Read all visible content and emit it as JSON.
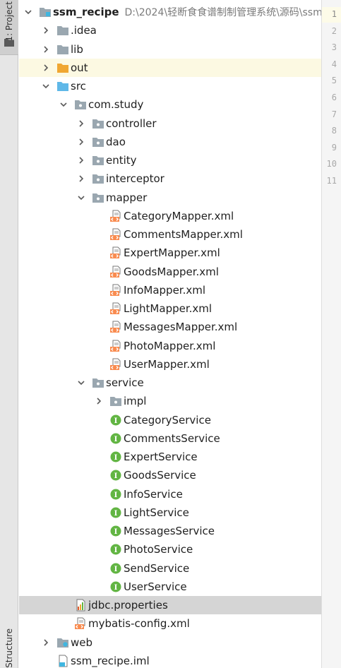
{
  "sidebar": {
    "project_tab": "1: Project",
    "structure_tab": "Structure"
  },
  "gutter": {
    "line_numbers": [
      "1",
      "2",
      "3",
      "4",
      "5",
      "6",
      "7",
      "8",
      "9",
      "10",
      "11"
    ]
  },
  "tree": {
    "root_name": "ssm_recipe",
    "root_path": "D:\\2024\\轻断食食谱制制管理系统\\源码\\ssm",
    "nodes": [
      {
        "label": "ssm_recipe",
        "level": 0,
        "arrow": "down",
        "icon": "module-folder-icon",
        "name": "tree-node-ssm-recipe"
      },
      {
        "label": ".idea",
        "level": 1,
        "arrow": "right",
        "icon": "folder-icon",
        "name": "tree-node-idea"
      },
      {
        "label": "lib",
        "level": 1,
        "arrow": "right",
        "icon": "folder-icon",
        "name": "tree-node-lib"
      },
      {
        "label": "out",
        "level": 1,
        "arrow": "right",
        "icon": "excluded-folder-icon",
        "name": "tree-node-out"
      },
      {
        "label": "src",
        "level": 1,
        "arrow": "down",
        "icon": "source-folder-icon",
        "name": "tree-node-src"
      },
      {
        "label": "com.study",
        "level": 2,
        "arrow": "down",
        "icon": "package-icon",
        "name": "tree-node-com-study"
      },
      {
        "label": "controller",
        "level": 3,
        "arrow": "right",
        "icon": "package-icon",
        "name": "tree-node-controller"
      },
      {
        "label": "dao",
        "level": 3,
        "arrow": "right",
        "icon": "package-icon",
        "name": "tree-node-dao"
      },
      {
        "label": "entity",
        "level": 3,
        "arrow": "right",
        "icon": "package-icon",
        "name": "tree-node-entity"
      },
      {
        "label": "interceptor",
        "level": 3,
        "arrow": "right",
        "icon": "package-icon",
        "name": "tree-node-interceptor"
      },
      {
        "label": "mapper",
        "level": 3,
        "arrow": "down",
        "icon": "package-icon",
        "name": "tree-node-mapper"
      },
      {
        "label": "CategoryMapper.xml",
        "level": 4,
        "arrow": "none",
        "icon": "xml-file-icon",
        "name": "tree-node-category-mapper"
      },
      {
        "label": "CommentsMapper.xml",
        "level": 4,
        "arrow": "none",
        "icon": "xml-file-icon",
        "name": "tree-node-comments-mapper"
      },
      {
        "label": "ExpertMapper.xml",
        "level": 4,
        "arrow": "none",
        "icon": "xml-file-icon",
        "name": "tree-node-expert-mapper"
      },
      {
        "label": "GoodsMapper.xml",
        "level": 4,
        "arrow": "none",
        "icon": "xml-file-icon",
        "name": "tree-node-goods-mapper"
      },
      {
        "label": "InfoMapper.xml",
        "level": 4,
        "arrow": "none",
        "icon": "xml-file-icon",
        "name": "tree-node-info-mapper"
      },
      {
        "label": "LightMapper.xml",
        "level": 4,
        "arrow": "none",
        "icon": "xml-file-icon",
        "name": "tree-node-light-mapper"
      },
      {
        "label": "MessagesMapper.xml",
        "level": 4,
        "arrow": "none",
        "icon": "xml-file-icon",
        "name": "tree-node-messages-mapper"
      },
      {
        "label": "PhotoMapper.xml",
        "level": 4,
        "arrow": "none",
        "icon": "xml-file-icon",
        "name": "tree-node-photo-mapper"
      },
      {
        "label": "UserMapper.xml",
        "level": 4,
        "arrow": "none",
        "icon": "xml-file-icon",
        "name": "tree-node-user-mapper"
      },
      {
        "label": "service",
        "level": 3,
        "arrow": "down",
        "icon": "package-icon",
        "name": "tree-node-service"
      },
      {
        "label": "impl",
        "level": 4,
        "arrow": "right",
        "icon": "package-icon",
        "name": "tree-node-impl"
      },
      {
        "label": "CategoryService",
        "level": 4,
        "arrow": "none",
        "icon": "interface-icon",
        "name": "tree-node-category-service"
      },
      {
        "label": "CommentsService",
        "level": 4,
        "arrow": "none",
        "icon": "interface-icon",
        "name": "tree-node-comments-service"
      },
      {
        "label": "ExpertService",
        "level": 4,
        "arrow": "none",
        "icon": "interface-icon",
        "name": "tree-node-expert-service"
      },
      {
        "label": "GoodsService",
        "level": 4,
        "arrow": "none",
        "icon": "interface-icon",
        "name": "tree-node-goods-service"
      },
      {
        "label": "InfoService",
        "level": 4,
        "arrow": "none",
        "icon": "interface-icon",
        "name": "tree-node-info-service"
      },
      {
        "label": "LightService",
        "level": 4,
        "arrow": "none",
        "icon": "interface-icon",
        "name": "tree-node-light-service"
      },
      {
        "label": "MessagesService",
        "level": 4,
        "arrow": "none",
        "icon": "interface-icon",
        "name": "tree-node-messages-service"
      },
      {
        "label": "PhotoService",
        "level": 4,
        "arrow": "none",
        "icon": "interface-icon",
        "name": "tree-node-photo-service"
      },
      {
        "label": "SendService",
        "level": 4,
        "arrow": "none",
        "icon": "interface-icon",
        "name": "tree-node-send-service"
      },
      {
        "label": "UserService",
        "level": 4,
        "arrow": "none",
        "icon": "interface-icon",
        "name": "tree-node-user-service"
      },
      {
        "label": "jdbc.properties",
        "level": 2,
        "arrow": "none",
        "icon": "properties-file-icon",
        "name": "tree-node-jdbc-properties"
      },
      {
        "label": "mybatis-config.xml",
        "level": 2,
        "arrow": "none",
        "icon": "xml-file-icon",
        "name": "tree-node-mybatis-config"
      },
      {
        "label": "web",
        "level": 1,
        "arrow": "right",
        "icon": "web-folder-icon",
        "name": "tree-node-web"
      },
      {
        "label": "ssm_recipe.iml",
        "level": 1,
        "arrow": "none",
        "icon": "iml-file-icon",
        "name": "tree-node-ssm-recipe-iml"
      }
    ],
    "highlighted_node": "out",
    "selected_node": "jdbc.properties"
  },
  "colors": {
    "folder_gray": "#9aa7b0",
    "excluded_orange": "#f0a732",
    "source_blue": "#5fb8e8",
    "interface_green": "#62b543",
    "xml_orange": "#f98b4f",
    "highlight_row": "#fcf9e2",
    "selected_row": "#d5d5d5"
  }
}
